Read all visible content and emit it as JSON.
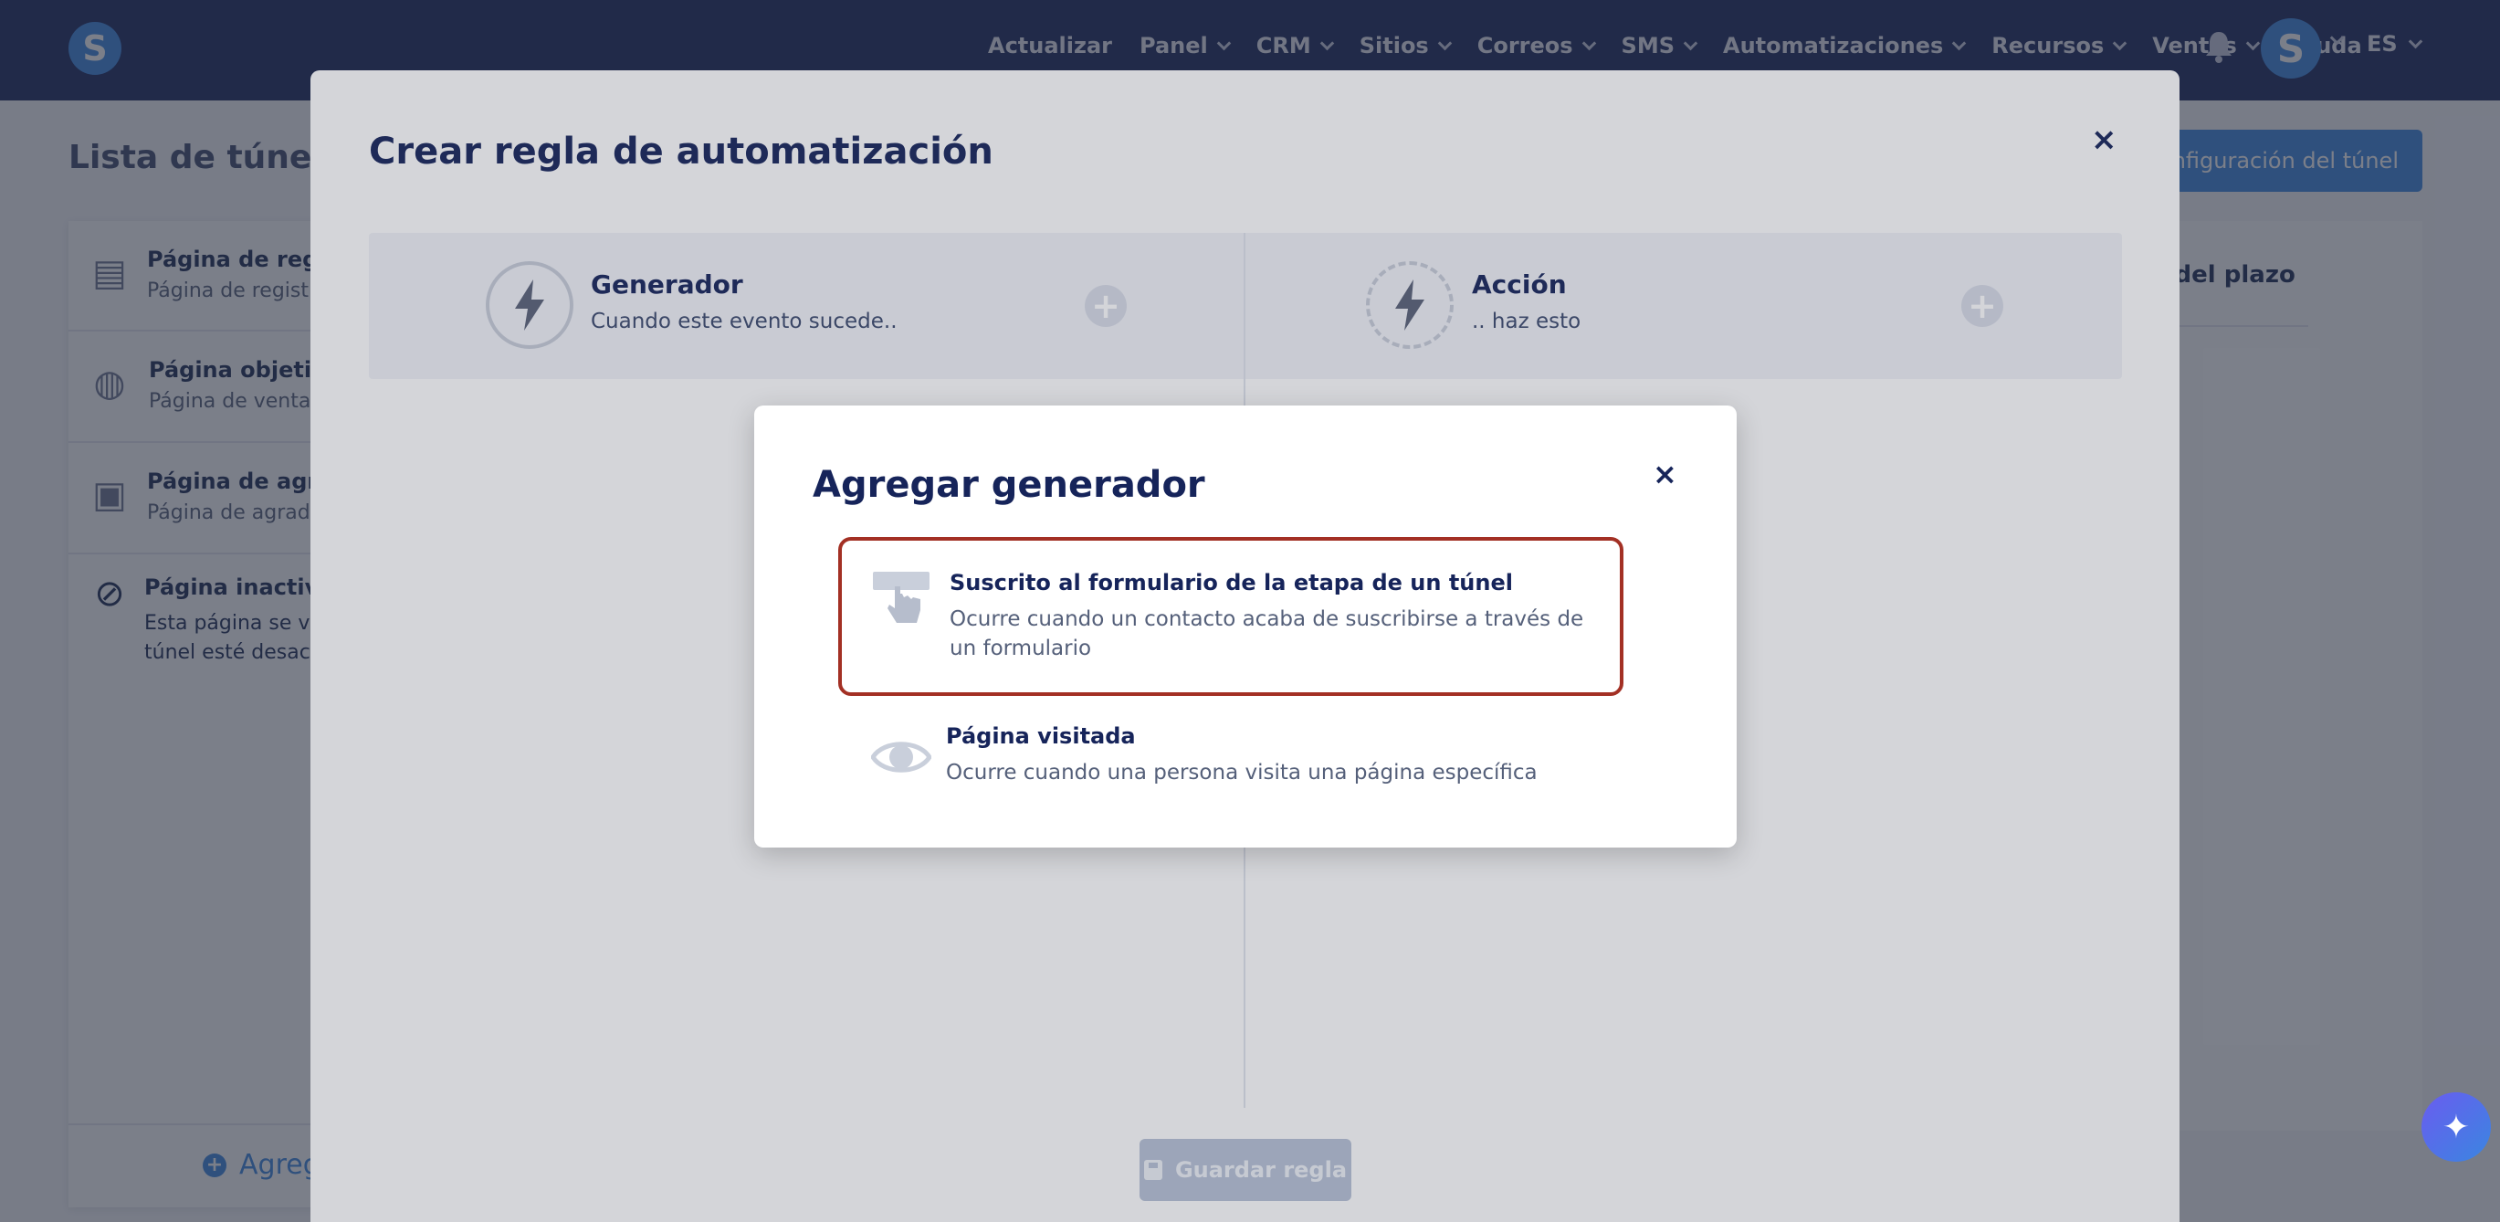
{
  "brand": {
    "logo_letter": "S",
    "avatar_letter": "S"
  },
  "nav": {
    "items": [
      {
        "label": "Actualizar",
        "dropdown": false
      },
      {
        "label": "Panel",
        "dropdown": true
      },
      {
        "label": "CRM",
        "dropdown": true
      },
      {
        "label": "Sitios",
        "dropdown": true
      },
      {
        "label": "Correos",
        "dropdown": true
      },
      {
        "label": "SMS",
        "dropdown": true
      },
      {
        "label": "Automatizaciones",
        "dropdown": true
      },
      {
        "label": "Recursos",
        "dropdown": true
      },
      {
        "label": "Ventas",
        "dropdown": true
      },
      {
        "label": "Ayuda",
        "dropdown": false
      }
    ],
    "language": "ES"
  },
  "background": {
    "page_title": "Lista de túneles",
    "config_button": "Configuración del túnel",
    "right_header": "n del plazo",
    "steps": [
      {
        "title": "Página de regis",
        "subtitle": "Página de registr",
        "icon": "registration-form-icon"
      },
      {
        "title": "Página objetivo",
        "subtitle": "Página de venta",
        "icon": "coins-icon"
      },
      {
        "title": "Página de agrad",
        "subtitle": "Página de agrade",
        "icon": "clipboard-check-icon"
      },
      {
        "title": "Página inactiva",
        "text": "Esta página se visu túnel esté desactiv",
        "icon": "ban-icon"
      }
    ],
    "add_link": "Agreg"
  },
  "modal": {
    "title": "Crear regla de automatización",
    "close_icon": "×",
    "trigger": {
      "title": "Generador",
      "subtitle": "Cuando este evento sucede.."
    },
    "action": {
      "title": "Acción",
      "subtitle": ".. haz esto"
    },
    "save_button": "Guardar regla"
  },
  "dialog": {
    "title": "Agregar generador",
    "close_icon": "×",
    "options": [
      {
        "title": "Suscrito al formulario de la etapa de un túnel",
        "description": "Ocurre cuando un contacto acaba de suscribirse a través de un formulario",
        "selected": true,
        "icon": "form-click-icon"
      },
      {
        "title": "Página visitada",
        "description": "Ocurre cuando una persona visita una página específica",
        "selected": false,
        "icon": "eye-icon"
      }
    ]
  },
  "colors": {
    "nav_bg": "#16245a",
    "accent": "#3a86e0",
    "selected_border": "#a33024"
  }
}
